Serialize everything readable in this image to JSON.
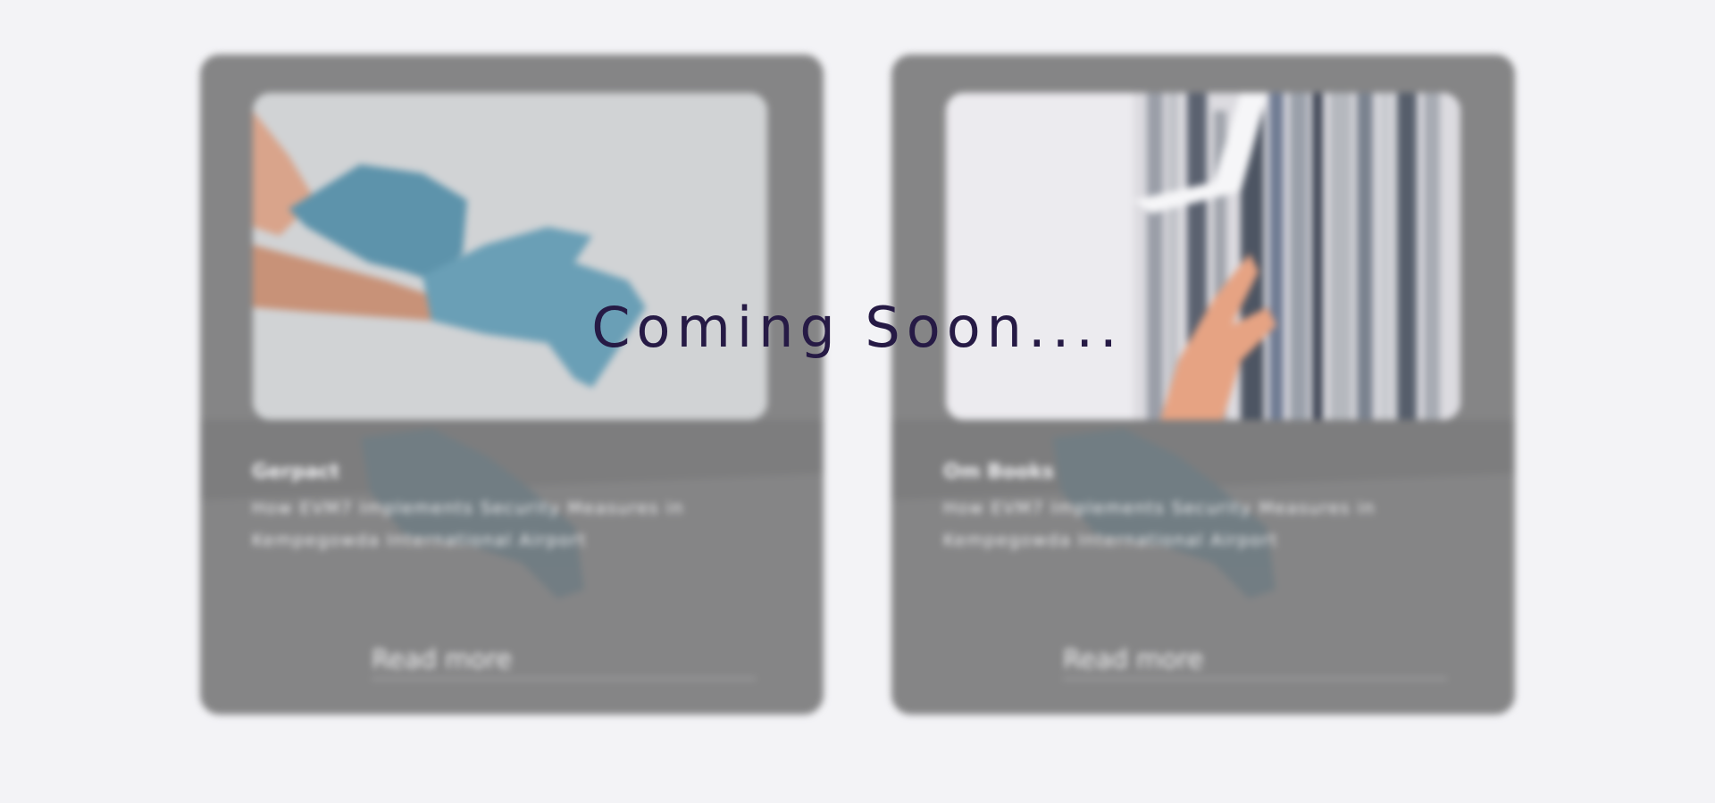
{
  "overlay": {
    "title": "Coming Soon...."
  },
  "cards": [
    {
      "source": "Gerpact",
      "description": "How EVM7 Implements Security Measures in Kempegowda International Airport",
      "read_more": "Read more",
      "image_icon": "gloved-hands-image"
    },
    {
      "source": "Om Books",
      "description": "How EVM7 Implements Security Measures in Kempegowda International Airport",
      "read_more": "Read more",
      "image_icon": "bookshelf-image"
    }
  ],
  "colors": {
    "page_background": "#f3f3f6",
    "card_overlay": "#858586",
    "title_color": "#261a45",
    "glove_color": "#5d93ab"
  }
}
